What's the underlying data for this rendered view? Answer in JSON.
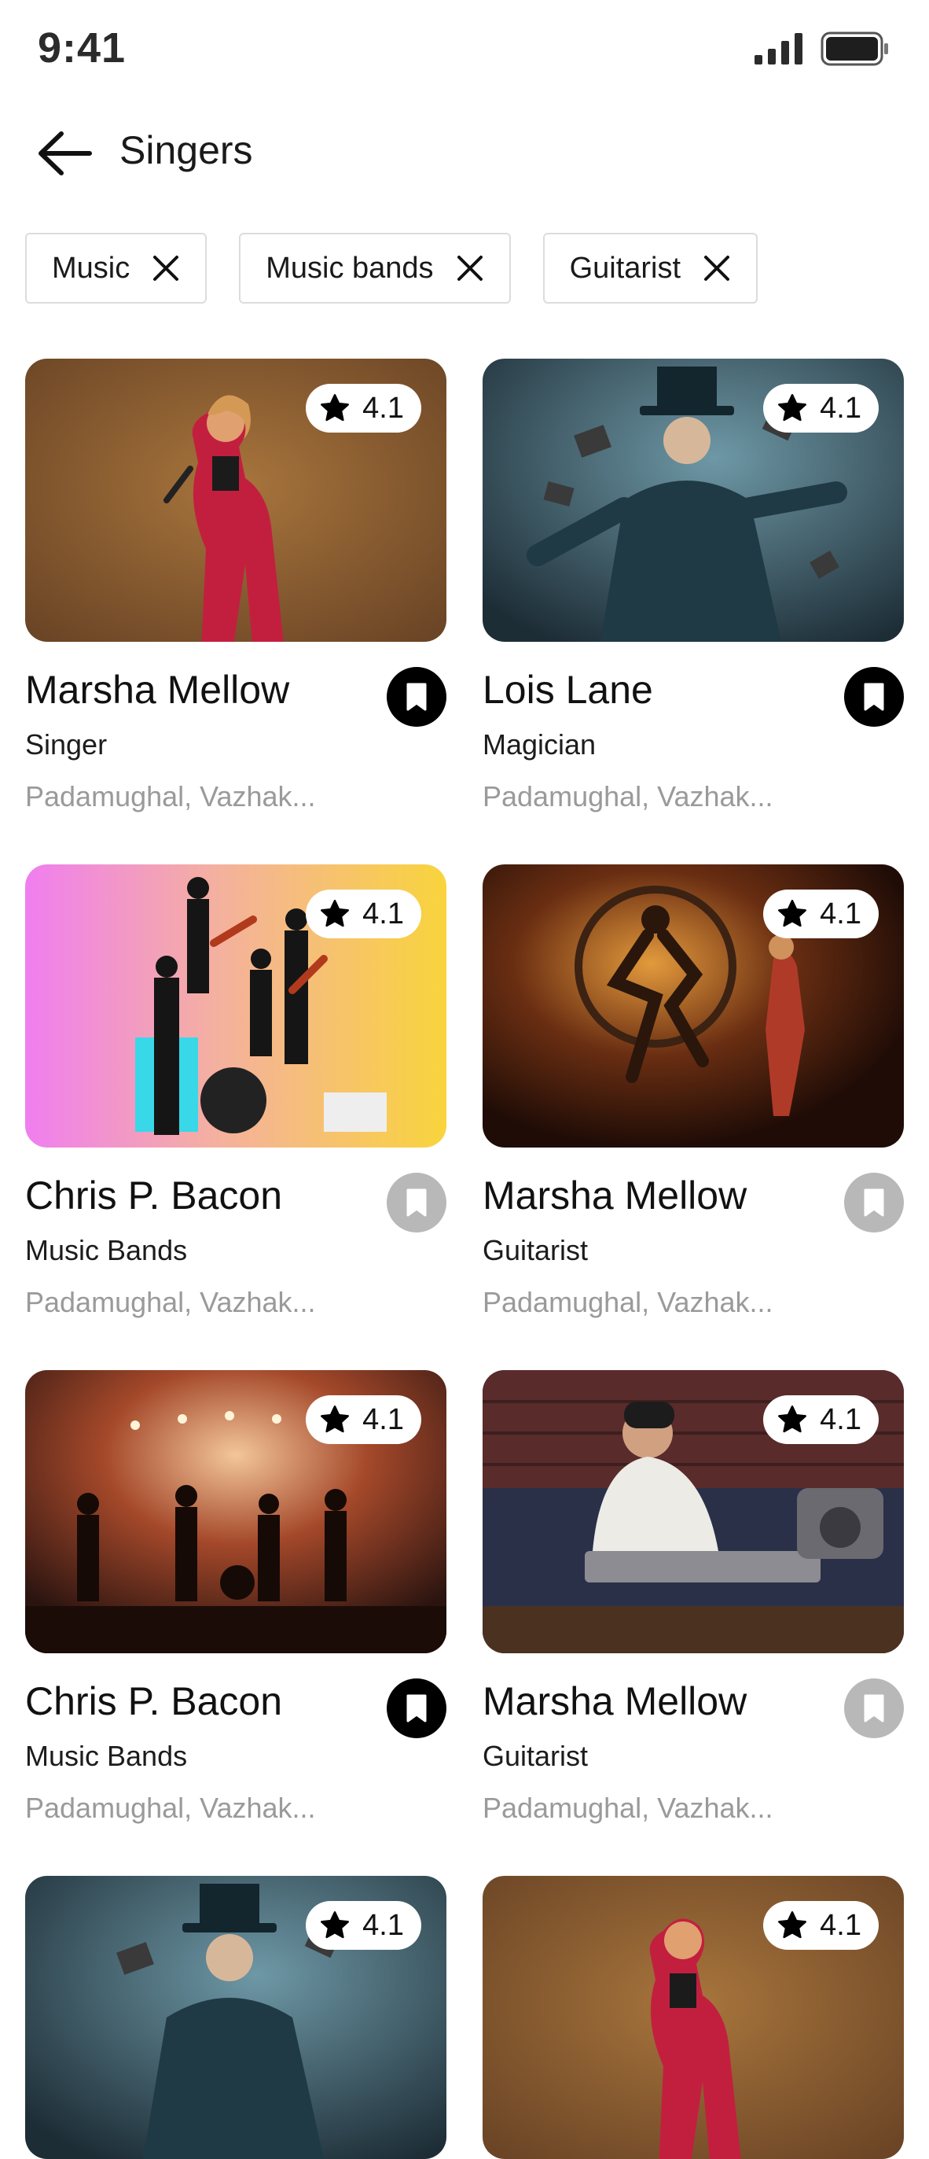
{
  "status_bar": {
    "time": "9:41"
  },
  "header": {
    "title": "Singers"
  },
  "chips": [
    {
      "label": "Music"
    },
    {
      "label": "Music bands"
    },
    {
      "label": "Guitarist"
    }
  ],
  "cards": [
    {
      "name": "Marsha Mellow",
      "category": "Singer",
      "location": "Padamughal, Vazhak...",
      "rating": "4.1",
      "bookmarked": true,
      "image": "singer-photo"
    },
    {
      "name": "Lois Lane",
      "category": "Magician",
      "location": "Padamughal, Vazhak...",
      "rating": "4.1",
      "bookmarked": true,
      "image": "magician-photo"
    },
    {
      "name": "Chris P. Bacon",
      "category": "Music Bands",
      "location": "Padamughal, Vazhak...",
      "rating": "4.1",
      "bookmarked": false,
      "image": "band-photo"
    },
    {
      "name": "Marsha Mellow",
      "category": "Guitarist",
      "location": "Padamughal, Vazhak...",
      "rating": "4.1",
      "bookmarked": false,
      "image": "dancer-photo"
    },
    {
      "name": "Chris P. Bacon",
      "category": "Music Bands",
      "location": "Padamughal, Vazhak...",
      "rating": "4.1",
      "bookmarked": true,
      "image": "concert-photo"
    },
    {
      "name": "Marsha Mellow",
      "category": "Guitarist",
      "location": "Padamughal, Vazhak...",
      "rating": "4.1",
      "bookmarked": false,
      "image": "keyboard-photo"
    },
    {
      "rating": "4.1",
      "image": "magician-photo"
    },
    {
      "rating": "4.1",
      "image": "singer-photo"
    }
  ],
  "colors": {
    "bookmark_active": "#000000",
    "bookmark_inactive": "#b8b8b8",
    "chip_border": "#dcdcdc",
    "location_text": "#9a9a9a"
  }
}
